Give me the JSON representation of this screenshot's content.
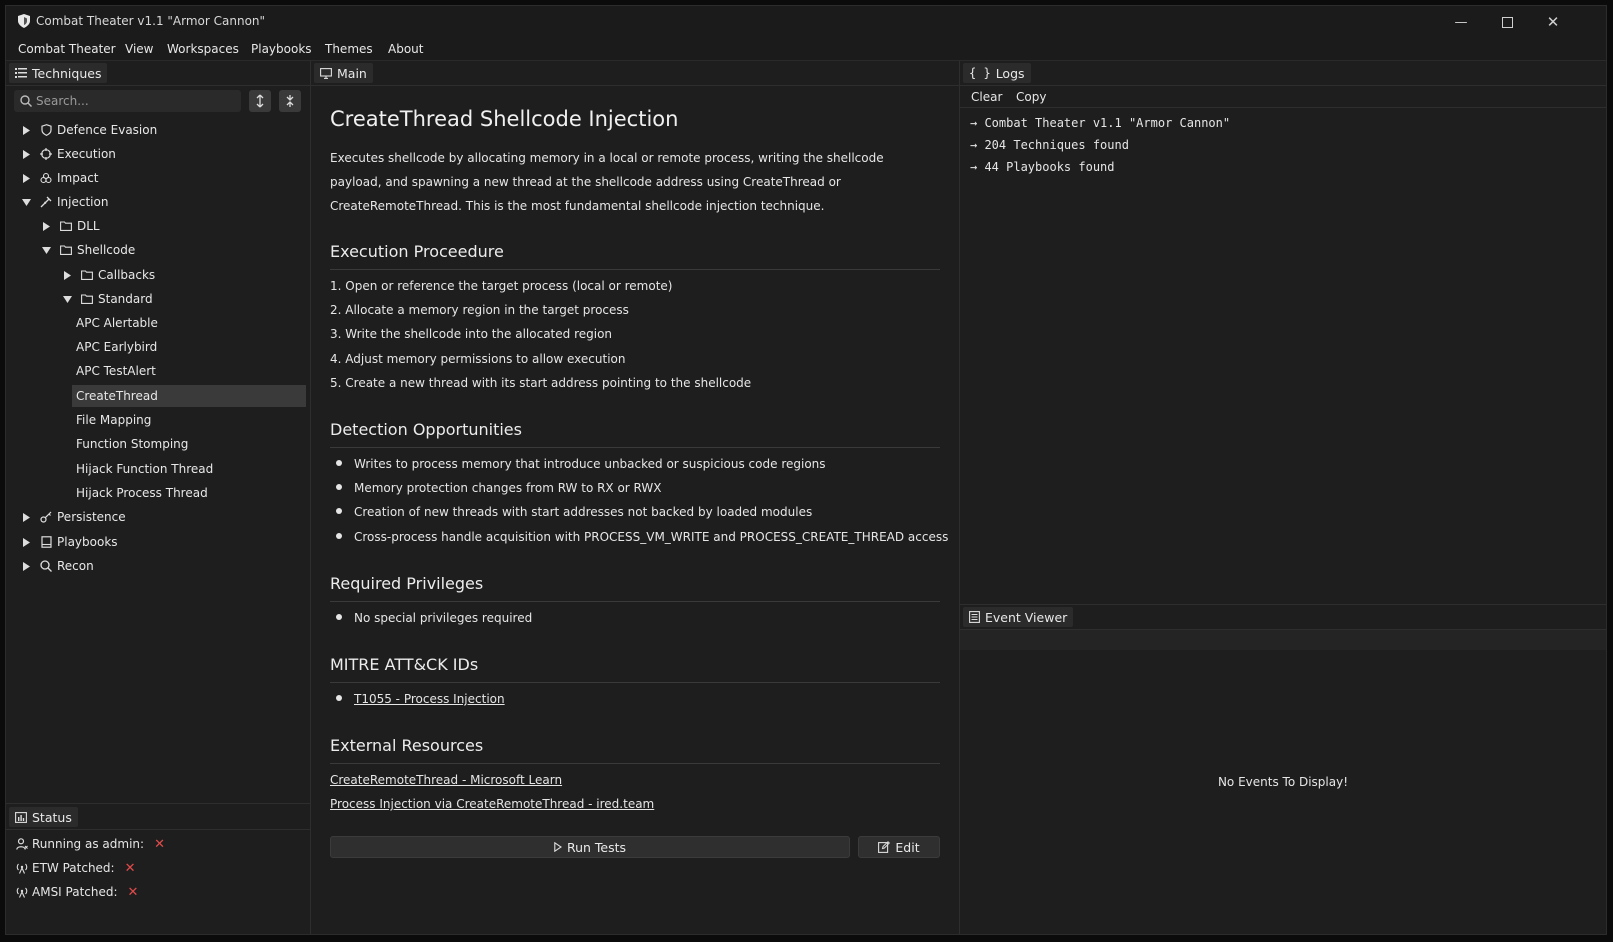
{
  "window": {
    "title": "Combat Theater v1.1 \"Armor Cannon\""
  },
  "menu": [
    "Combat Theater",
    "View",
    "Workspaces",
    "Playbooks",
    "Themes",
    "About"
  ],
  "techniques": {
    "tab_label": "Techniques",
    "search_placeholder": "Search...",
    "tree": {
      "defence_evasion": "Defence Evasion",
      "execution": "Execution",
      "impact": "Impact",
      "injection": "Injection",
      "dll": "DLL",
      "shellcode": "Shellcode",
      "callbacks": "Callbacks",
      "standard": "Standard",
      "leaves": [
        "APC Alertable",
        "APC Earlybird",
        "APC TestAlert",
        "CreateThread",
        "File Mapping",
        "Function Stomping",
        "Hijack Function Thread",
        "Hijack Process Thread"
      ],
      "selected_leaf": "CreateThread",
      "persistence": "Persistence",
      "playbooks": "Playbooks",
      "recon": "Recon"
    }
  },
  "status": {
    "tab_label": "Status",
    "rows": [
      {
        "label": "Running as admin:",
        "value": "✕"
      },
      {
        "label": "ETW Patched:",
        "value": "✕"
      },
      {
        "label": "AMSI Patched:",
        "value": "✕"
      }
    ]
  },
  "main": {
    "tab_label": "Main",
    "title": "CreateThread Shellcode Injection",
    "description": "Executes shellcode by allocating memory in a local or remote process, writing the shellcode payload, and spawning a new thread at the shellcode address using CreateThread or CreateRemoteThread. This is the most fundamental shellcode injection technique.",
    "procedure_heading": "Execution Proceedure",
    "procedure": [
      "1. Open or reference the target process (local or remote)",
      "2. Allocate a memory region in the target process",
      "3. Write the shellcode into the allocated region",
      "4. Adjust memory permissions to allow execution",
      "5. Create a new thread with its start address pointing to the shellcode"
    ],
    "detection_heading": "Detection Opportunities",
    "detection": [
      "Writes to process memory that introduce unbacked or suspicious code regions",
      "Memory protection changes from RW to RX or RWX",
      "Creation of new threads with start addresses not backed by loaded modules",
      "Cross-process handle acquisition with PROCESS_VM_WRITE and PROCESS_CREATE_THREAD access"
    ],
    "privileges_heading": "Required Privileges",
    "privileges": [
      "No special privileges required"
    ],
    "mitre_heading": "MITRE ATT&CK IDs",
    "mitre": [
      "T1055 - Process Injection"
    ],
    "resources_heading": "External Resources",
    "resources": [
      "CreateRemoteThread - Microsoft Learn",
      "Process Injection via CreateRemoteThread - ired.team"
    ],
    "run_tests_label": "Run Tests",
    "edit_label": "Edit"
  },
  "logs": {
    "tab_label": "Logs",
    "clear_label": "Clear",
    "copy_label": "Copy",
    "lines": [
      "Combat Theater v1.1 \"Armor Cannon\"",
      "204 Techniques found",
      "44 Playbooks found"
    ]
  },
  "event_viewer": {
    "tab_label": "Event Viewer",
    "empty_text": "No Events To Display!"
  },
  "colors": {
    "background": "#1e1e1e",
    "selected": "#3a3a3a",
    "error": "#e24b4b"
  }
}
